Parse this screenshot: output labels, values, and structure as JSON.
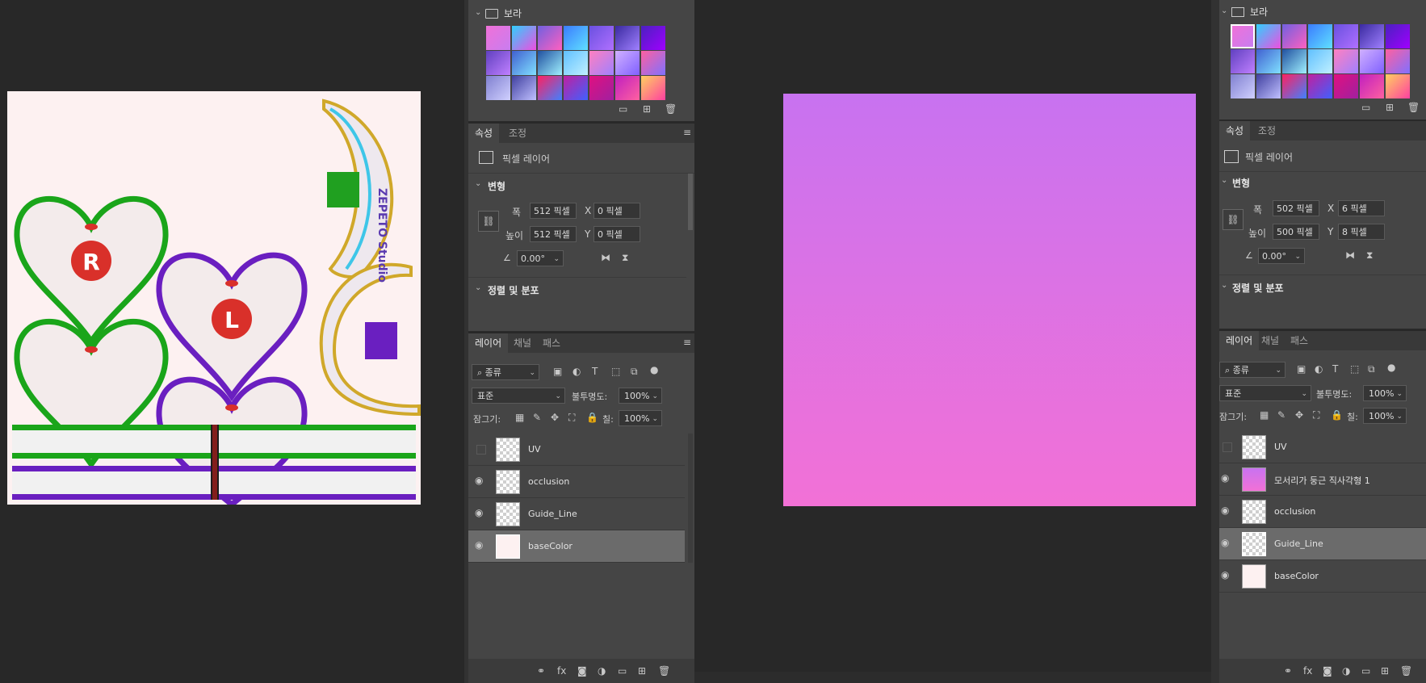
{
  "colors": {
    "canvas": "#282828",
    "panel": "#454545",
    "selected_row": "#6b6b6b",
    "gradient_top": "#c872f0",
    "gradient_bottom": "#f271d6"
  },
  "left_panel": {
    "swatch_group": {
      "folder_label": "보라"
    },
    "properties_tabs": [
      "속성",
      "조정"
    ],
    "layer_kind": "픽셀 레이어",
    "transform_label": "변형",
    "width_label": "폭",
    "width_value": "512 픽셀",
    "height_label": "높이",
    "height_value": "512 픽셀",
    "x_label": "X",
    "x_value": "0 픽셀",
    "y_label": "Y",
    "y_value": "0 픽셀",
    "angle_value": "0.00°",
    "align_label": "정렬 및 분포",
    "layers_tabs": [
      "레이어",
      "채널",
      "패스"
    ],
    "filter_label": "종류",
    "blend_mode": "표준",
    "opacity_label": "불투명도:",
    "opacity_value": "100%",
    "lock_label": "잠그기:",
    "fill_label": "칠:",
    "fill_value": "100%",
    "layers": [
      {
        "name": "UV",
        "visible": false
      },
      {
        "name": "occlusion",
        "visible": true
      },
      {
        "name": "Guide_Line",
        "visible": true
      },
      {
        "name": "baseColor",
        "visible": true,
        "selected": true
      }
    ]
  },
  "right_panel": {
    "swatch_group": {
      "folder_label": "보라"
    },
    "properties_tabs": [
      "속성",
      "조정"
    ],
    "layer_kind": "픽셀 레이어",
    "transform_label": "변형",
    "width_label": "폭",
    "width_value": "502 픽셀",
    "height_label": "높이",
    "height_value": "500 픽셀",
    "x_label": "X",
    "x_value": "6 픽셀",
    "y_label": "Y",
    "y_value": "8 픽셀",
    "angle_value": "0.00°",
    "align_label": "정렬 및 분포",
    "layers_tabs": [
      "레이어",
      "채널",
      "패스"
    ],
    "filter_label": "종류",
    "blend_mode": "표준",
    "opacity_label": "불투명도:",
    "opacity_value": "100%",
    "lock_label": "잠그기:",
    "fill_label": "칠:",
    "fill_value": "100%",
    "layers": [
      {
        "name": "UV",
        "visible": false
      },
      {
        "name": "모서리가 둥근 직사각형 1",
        "visible": true
      },
      {
        "name": "occlusion",
        "visible": true
      },
      {
        "name": "Guide_Line",
        "visible": true,
        "selected": true
      },
      {
        "name": "baseColor",
        "visible": true
      }
    ]
  },
  "texture": {
    "heart_letter_1": "R",
    "heart_letter_2": "L",
    "logo_text": "ZEPETO Studio"
  }
}
